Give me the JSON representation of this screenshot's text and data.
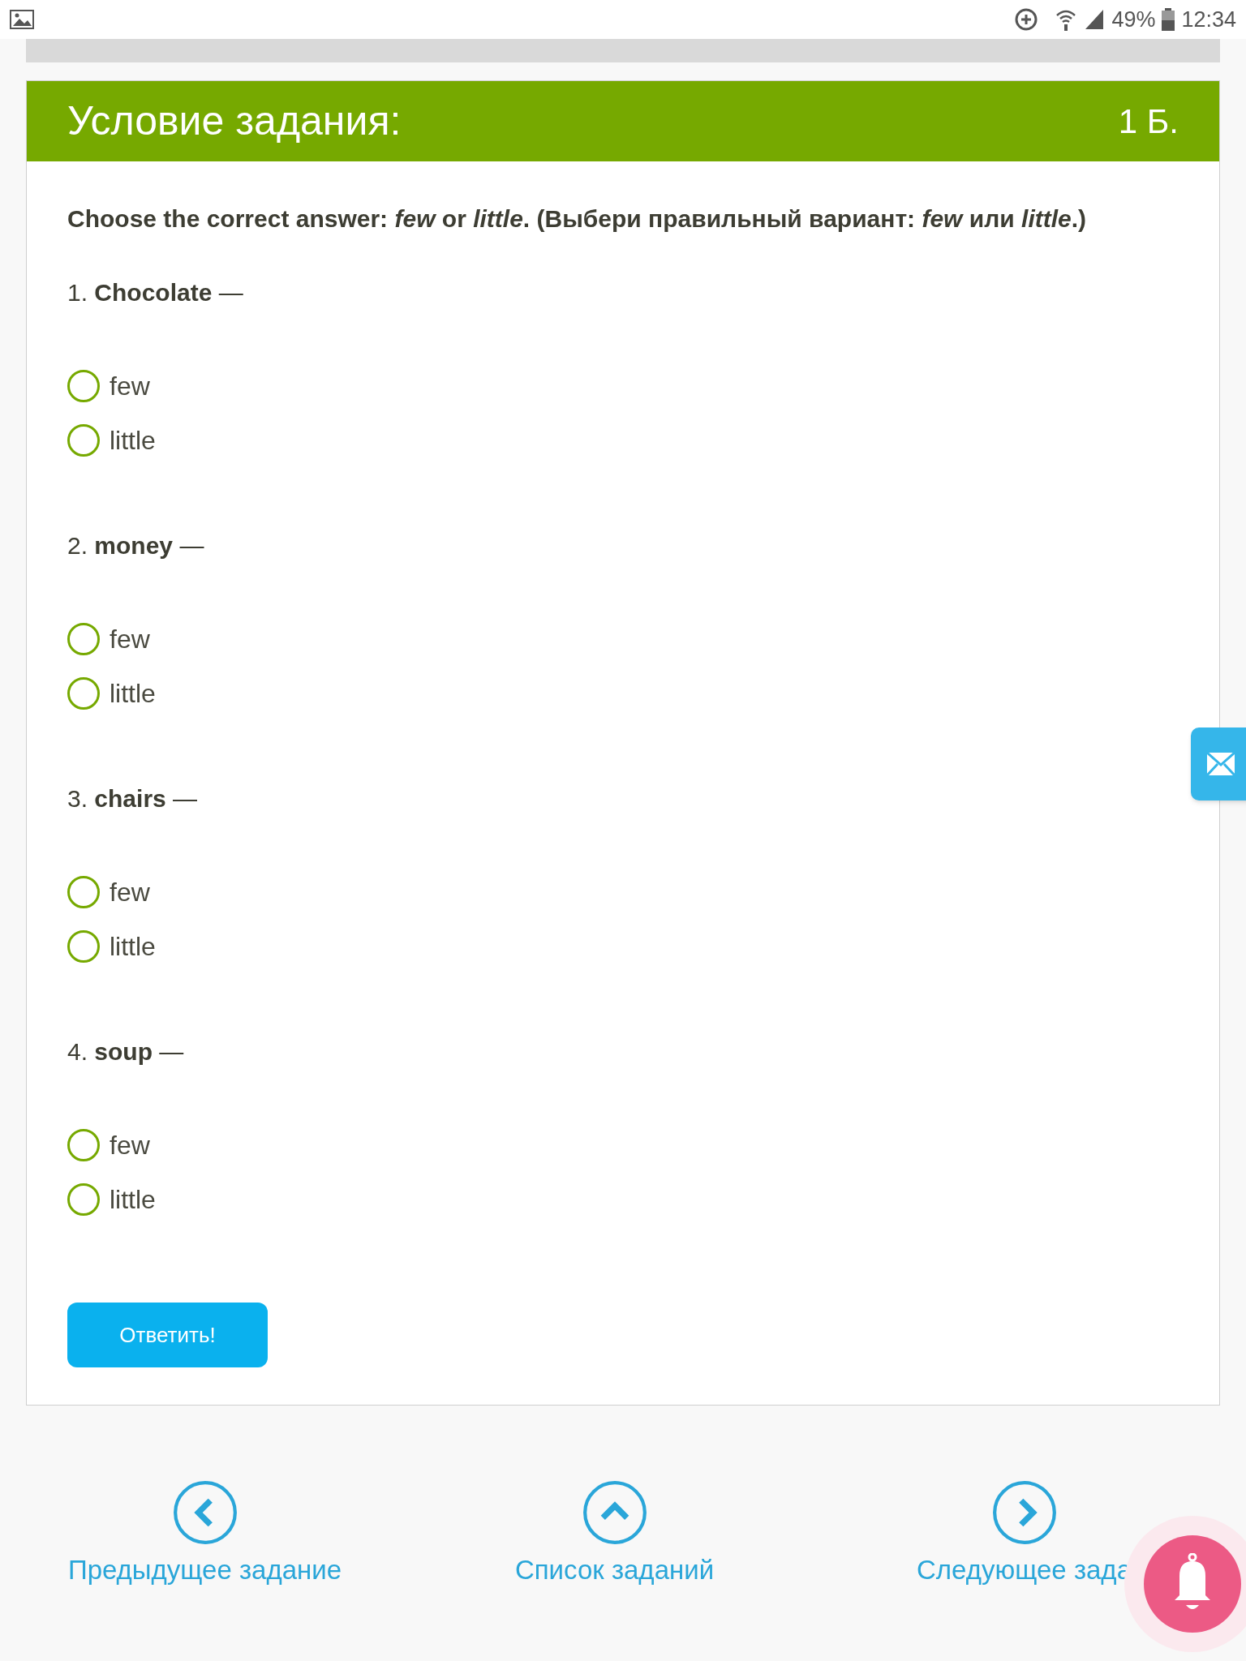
{
  "status_bar": {
    "battery": "49%",
    "time": "12:34"
  },
  "task": {
    "title": "Условие задания:",
    "points": "1 Б.",
    "instruction": "Choose the correct answer: *few* or *little*. (Выбери правильный вариант: *few* или *little*.)",
    "questions": [
      {
        "text": "1. **Chocolate** —",
        "options": [
          {
            "label": "few",
            "selected": false
          },
          {
            "label": "little",
            "selected": false
          }
        ]
      },
      {
        "text": "2. **money** —",
        "options": [
          {
            "label": "few",
            "selected": false
          },
          {
            "label": "little",
            "selected": false
          }
        ]
      },
      {
        "text": "3. **chairs** —",
        "options": [
          {
            "label": "few",
            "selected": false
          },
          {
            "label": "little",
            "selected": false
          }
        ]
      },
      {
        "text": "4. **soup** —",
        "options": [
          {
            "label": "few",
            "selected": false
          },
          {
            "label": "little",
            "selected": false
          }
        ]
      }
    ],
    "submit": "Ответить!"
  },
  "nav": [
    {
      "kind": "prev",
      "label": "Предыдущее задание"
    },
    {
      "kind": "list",
      "label": "Список заданий"
    },
    {
      "kind": "next",
      "label": "Следующее зада"
    }
  ]
}
